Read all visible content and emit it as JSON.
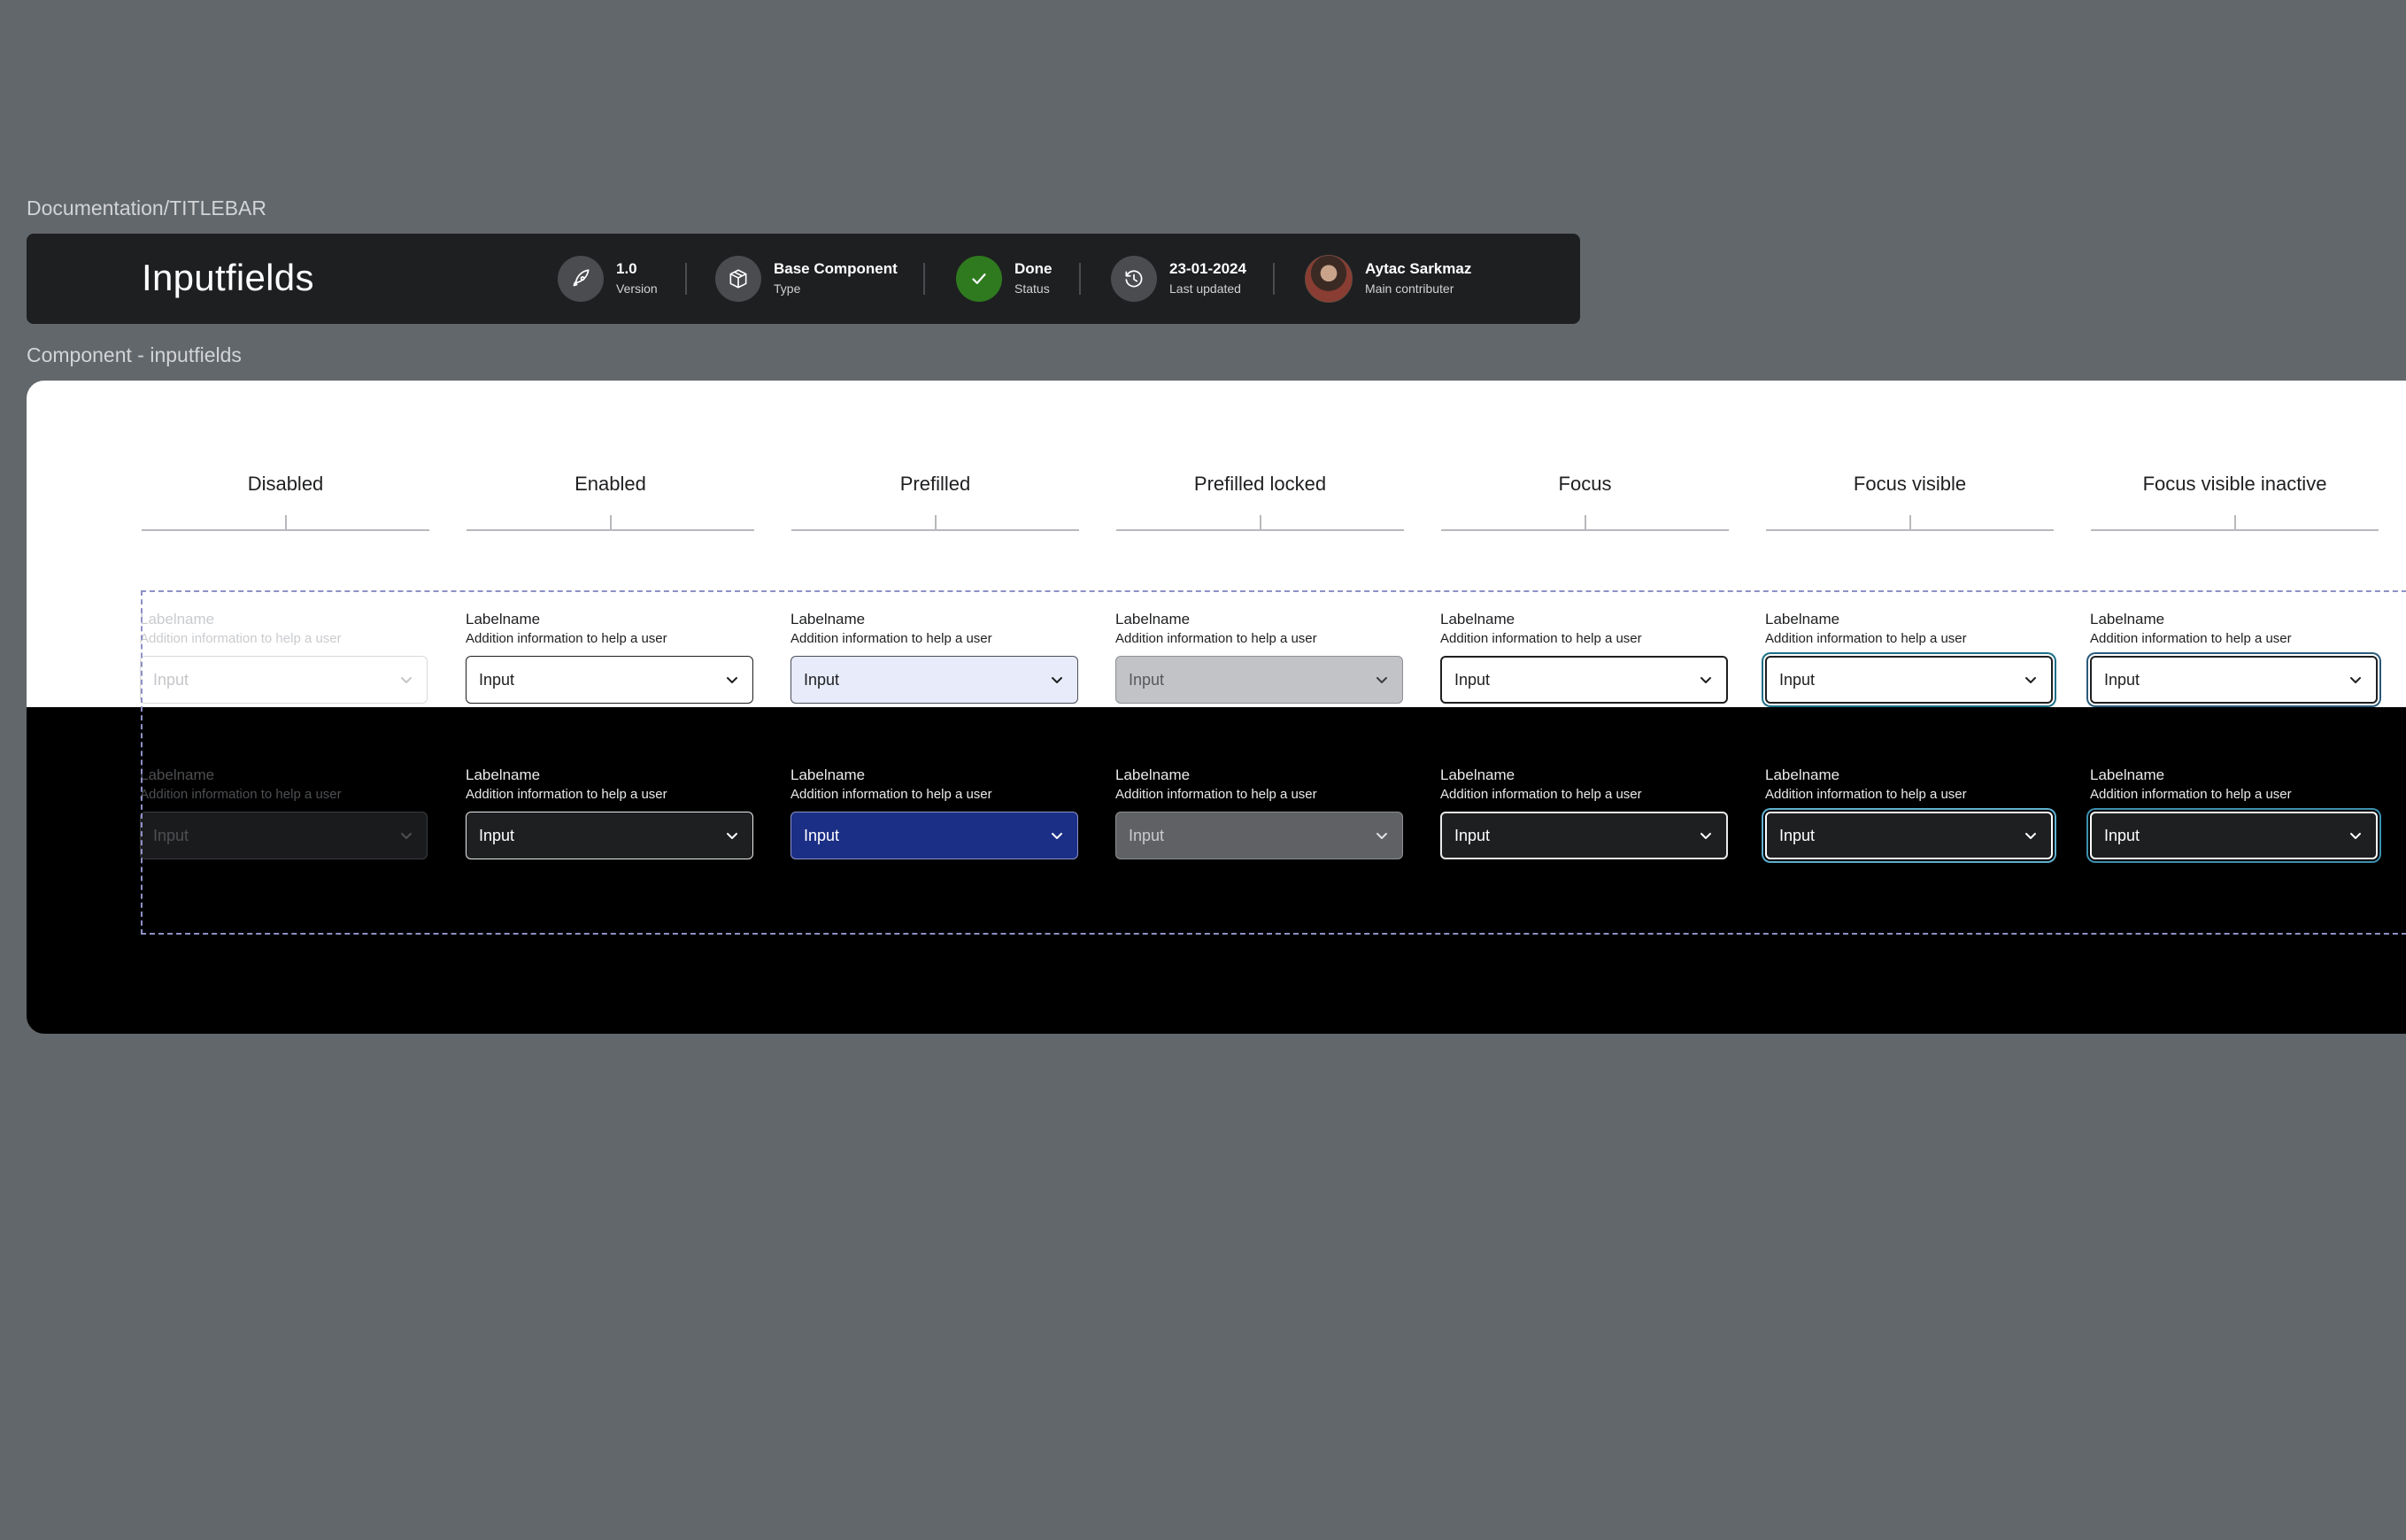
{
  "frames": {
    "titlebar_label": "Documentation/TITLEBAR",
    "component_label": "Component - inputfields"
  },
  "titlebar": {
    "title": "Inputfields",
    "meta": [
      {
        "icon": "rocket-icon",
        "value": "1.0",
        "key": "Version"
      },
      {
        "icon": "cube-icon",
        "value": "Base Component",
        "key": "Type"
      },
      {
        "icon": "check-icon",
        "value": "Done",
        "key": "Status",
        "color": "#2f7a1f"
      },
      {
        "icon": "clock-icon",
        "value": "23-01-2024",
        "key": "Last updated"
      },
      {
        "icon": "avatar",
        "value": "Aytac Sarkmaz",
        "key": "Main contributer"
      }
    ]
  },
  "columns": [
    "Disabled",
    "Enabled",
    "Prefilled",
    "Prefilled locked",
    "Focus",
    "Focus visible",
    "Focus visible inactive"
  ],
  "field": {
    "label": "Labelname",
    "help": "Addition information to help a user",
    "value": "Input"
  },
  "colors": {
    "background": "#62676b",
    "titlebar": "#1e1f21",
    "status_done": "#2f7a1f",
    "prefilled_light": "#e8ebfa",
    "prefilled_dark": "#1c2f86",
    "focus_ring": "#1b6f86"
  }
}
